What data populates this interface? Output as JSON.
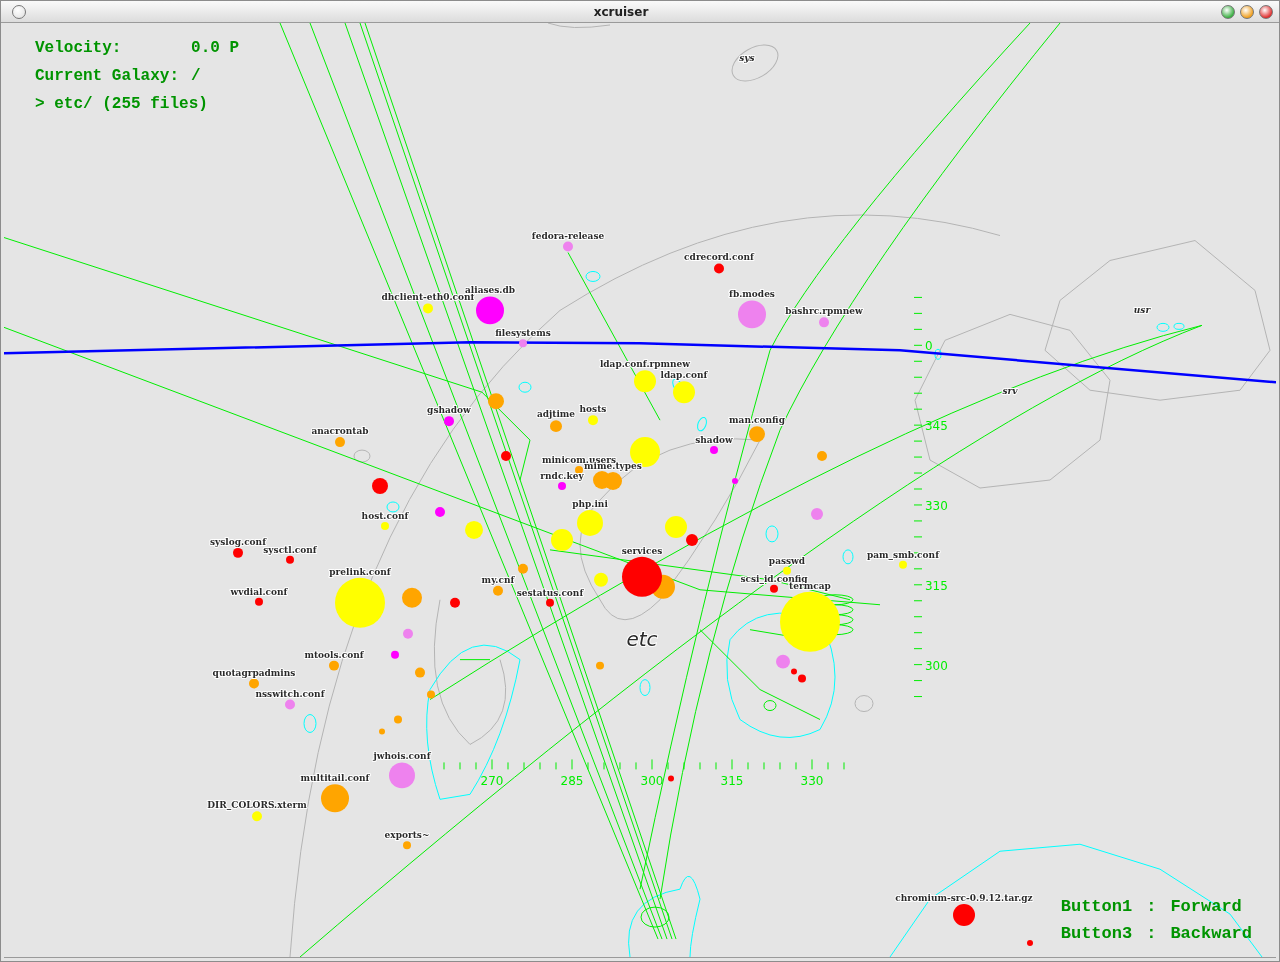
{
  "window": {
    "title": "xcruiser"
  },
  "hud": {
    "velocity_label": "Velocity:",
    "velocity_value": "0.0 P",
    "galaxy_label": "Current Galaxy:",
    "galaxy_value": "/",
    "directory": "> etc/ (255 files)"
  },
  "galaxy_name": "etc",
  "other_galaxies": [
    "sys",
    "usr",
    "srv"
  ],
  "files": [
    {
      "name": "fedora-release",
      "color": "#ee82ee"
    },
    {
      "name": "cdrecord.conf",
      "color": "#ff0000"
    },
    {
      "name": "dhclient-eth0.conf",
      "color": "#ffff00"
    },
    {
      "name": "aliases.db",
      "color": "#ff00ff"
    },
    {
      "name": "fb.modes",
      "color": "#ee82ee"
    },
    {
      "name": "bashrc.rpmnew",
      "color": "#ee82ee"
    },
    {
      "name": "filesystems",
      "color": "#ee82ee"
    },
    {
      "name": "ldap.conf.rpmnew",
      "color": "#ffff00"
    },
    {
      "name": "ldap.conf",
      "color": "#ffff00"
    },
    {
      "name": "hosts",
      "color": "#ffff00"
    },
    {
      "name": "gshadow",
      "color": "#ff00ff"
    },
    {
      "name": "adjtime",
      "color": "#ffa500"
    },
    {
      "name": "man.config",
      "color": "#ffa500"
    },
    {
      "name": "anacrontab",
      "color": "#ffa500"
    },
    {
      "name": "shadow",
      "color": "#ff00ff"
    },
    {
      "name": "minicom.users",
      "color": "#ffa500"
    },
    {
      "name": "mime.types",
      "color": "#ffa500"
    },
    {
      "name": "rndc.key",
      "color": "#ff00ff"
    },
    {
      "name": "php.ini",
      "color": "#ffff00"
    },
    {
      "name": "host.conf",
      "color": "#ffff00"
    },
    {
      "name": "syslog.conf",
      "color": "#ff0000"
    },
    {
      "name": "sysctl.conf",
      "color": "#ff0000"
    },
    {
      "name": "pam_smb.conf",
      "color": "#ffff00"
    },
    {
      "name": "passwd",
      "color": "#ffff00"
    },
    {
      "name": "services",
      "color": "#ff0000"
    },
    {
      "name": "my.cnf",
      "color": "#ffa500"
    },
    {
      "name": "scsi_id.config",
      "color": "#ff0000"
    },
    {
      "name": "wvdial.conf",
      "color": "#ff0000"
    },
    {
      "name": "prelink.conf",
      "color": "#ffff00"
    },
    {
      "name": "sestatus.conf",
      "color": "#ff0000"
    },
    {
      "name": "termcap",
      "color": "#ffff00"
    },
    {
      "name": "mtools.conf",
      "color": "#ffa500"
    },
    {
      "name": "quotagrpadmins",
      "color": "#ffa500"
    },
    {
      "name": "nsswitch.conf",
      "color": "#ee82ee"
    },
    {
      "name": "jwhois.conf",
      "color": "#ee82ee"
    },
    {
      "name": "multitail.conf",
      "color": "#ffa500"
    },
    {
      "name": "DIR_COLORS.xterm",
      "color": "#ffff00"
    },
    {
      "name": "exports~",
      "color": "#ffa500"
    },
    {
      "name": "chromium-src-0.9.12.tar.gz",
      "color": "#ff0000"
    }
  ],
  "horizontal_gauge": [
    "270",
    "285",
    "300",
    "315",
    "330"
  ],
  "vertical_gauge": [
    "0",
    "345",
    "330",
    "315",
    "300"
  ],
  "help": [
    {
      "button": "Button1",
      "separator": ":",
      "action": "Forward"
    },
    {
      "button": "Button3",
      "separator": ":",
      "action": "Backward"
    }
  ]
}
